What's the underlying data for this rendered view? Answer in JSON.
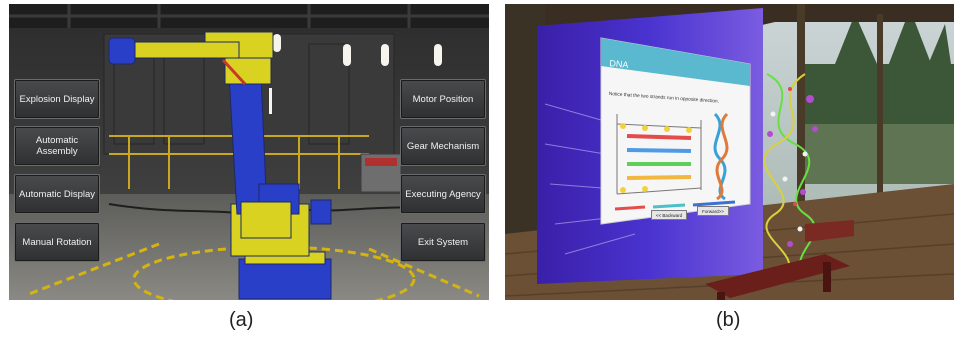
{
  "panel_a": {
    "caption": "(a)",
    "left_menu": [
      "Explosion Display",
      "Automatic Assembly",
      "Automatic Display",
      "Manual Rotation"
    ],
    "right_menu": [
      "Motor Position",
      "Gear Mechanism",
      "Executing Agency",
      "Exit System"
    ]
  },
  "panel_b": {
    "caption": "(b)",
    "slide_title": "DNA",
    "slide_text": "Notice that the two strands run in opposite direction.",
    "back_button": "<< Backward",
    "forward_button": "Forward>>"
  }
}
